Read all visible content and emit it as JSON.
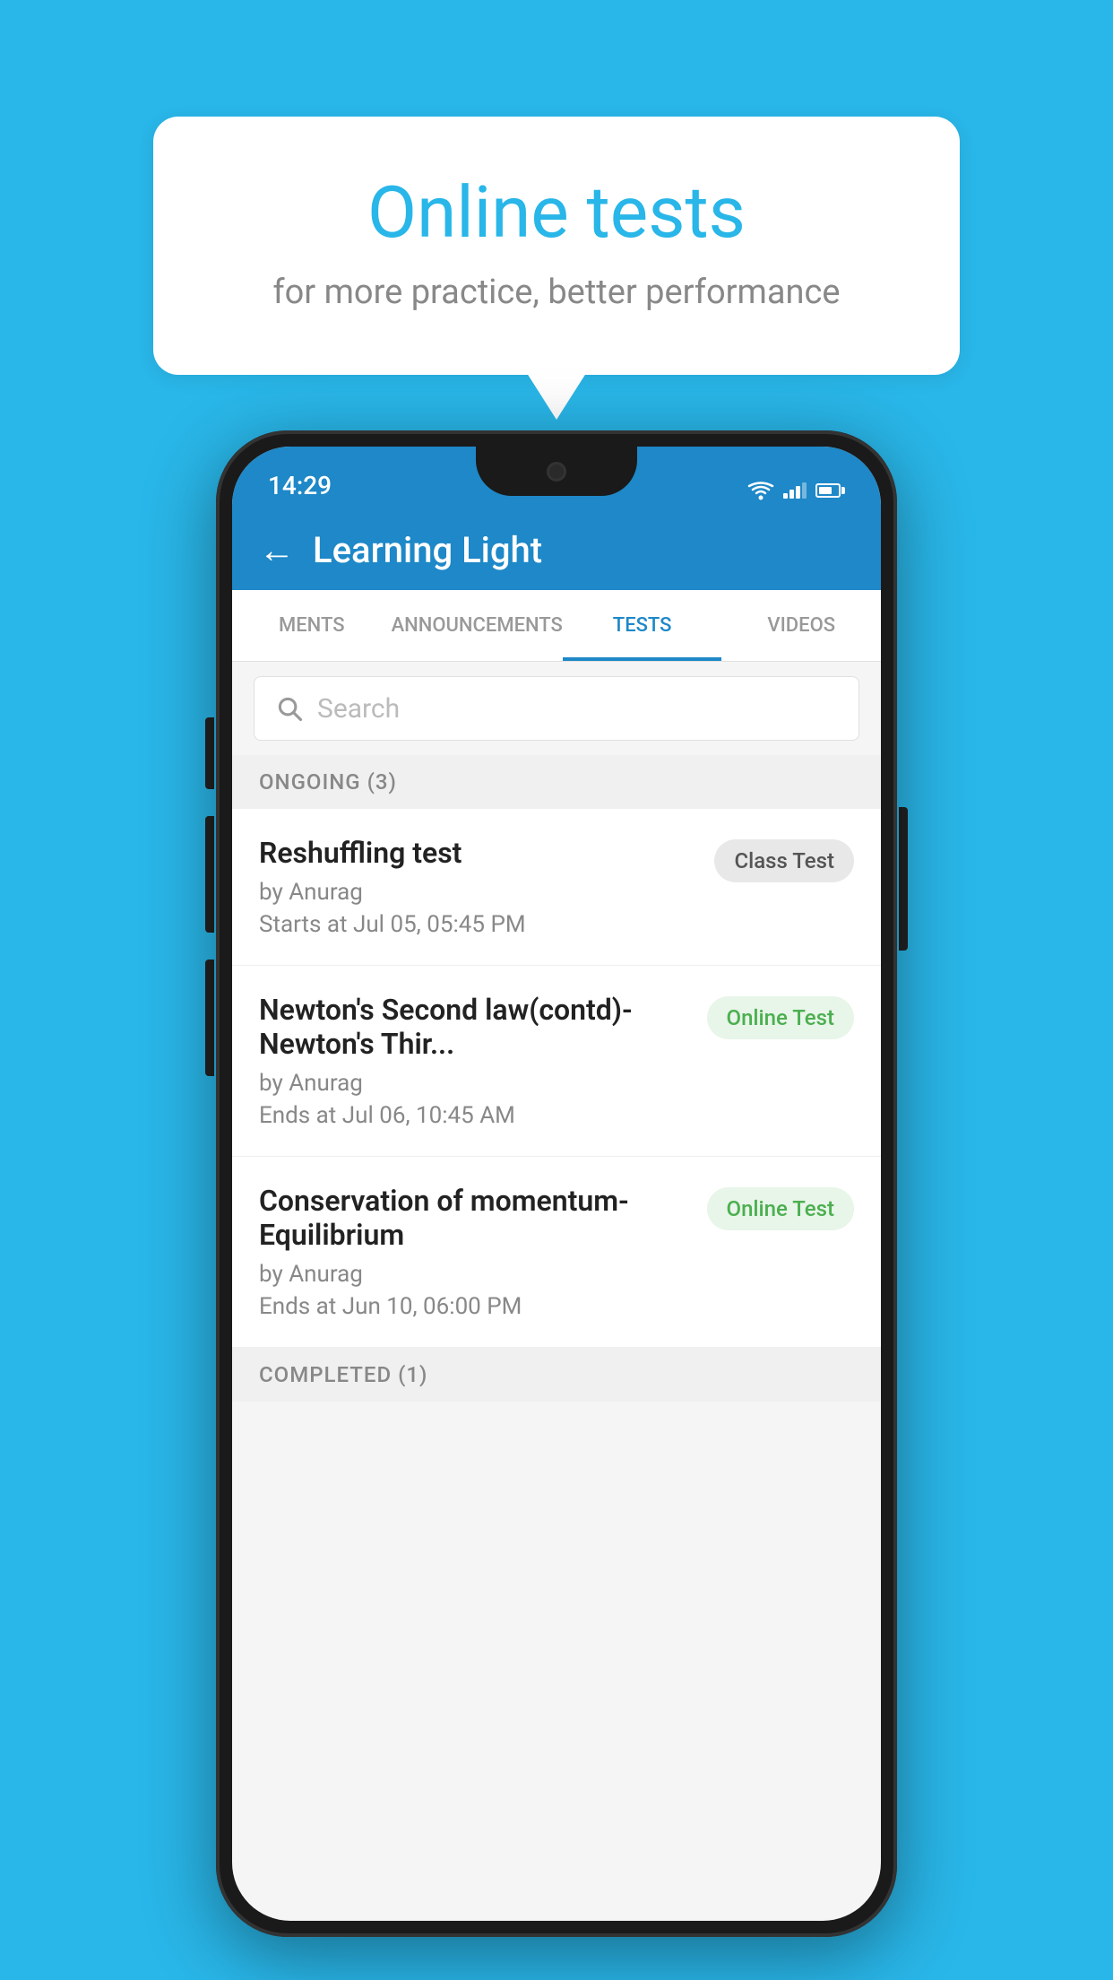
{
  "background": {
    "color": "#29B6E8"
  },
  "speech_bubble": {
    "title": "Online tests",
    "subtitle": "for more practice, better performance"
  },
  "phone": {
    "status_bar": {
      "time": "14:29"
    },
    "header": {
      "title": "Learning Light",
      "back_label": "←"
    },
    "tabs": [
      {
        "label": "MENTS",
        "active": false
      },
      {
        "label": "ANNOUNCEMENTS",
        "active": false
      },
      {
        "label": "TESTS",
        "active": true
      },
      {
        "label": "VIDEOS",
        "active": false
      }
    ],
    "search": {
      "placeholder": "Search"
    },
    "ongoing_section": {
      "label": "ONGOING (3)"
    },
    "tests": [
      {
        "name": "Reshuffling test",
        "author": "by Anurag",
        "date": "Starts at  Jul 05, 05:45 PM",
        "badge": "Class Test",
        "badge_type": "class"
      },
      {
        "name": "Newton's Second law(contd)-Newton's Thir...",
        "author": "by Anurag",
        "date": "Ends at  Jul 06, 10:45 AM",
        "badge": "Online Test",
        "badge_type": "online"
      },
      {
        "name": "Conservation of momentum-Equilibrium",
        "author": "by Anurag",
        "date": "Ends at  Jun 10, 06:00 PM",
        "badge": "Online Test",
        "badge_type": "online"
      }
    ],
    "completed_section": {
      "label": "COMPLETED (1)"
    }
  }
}
